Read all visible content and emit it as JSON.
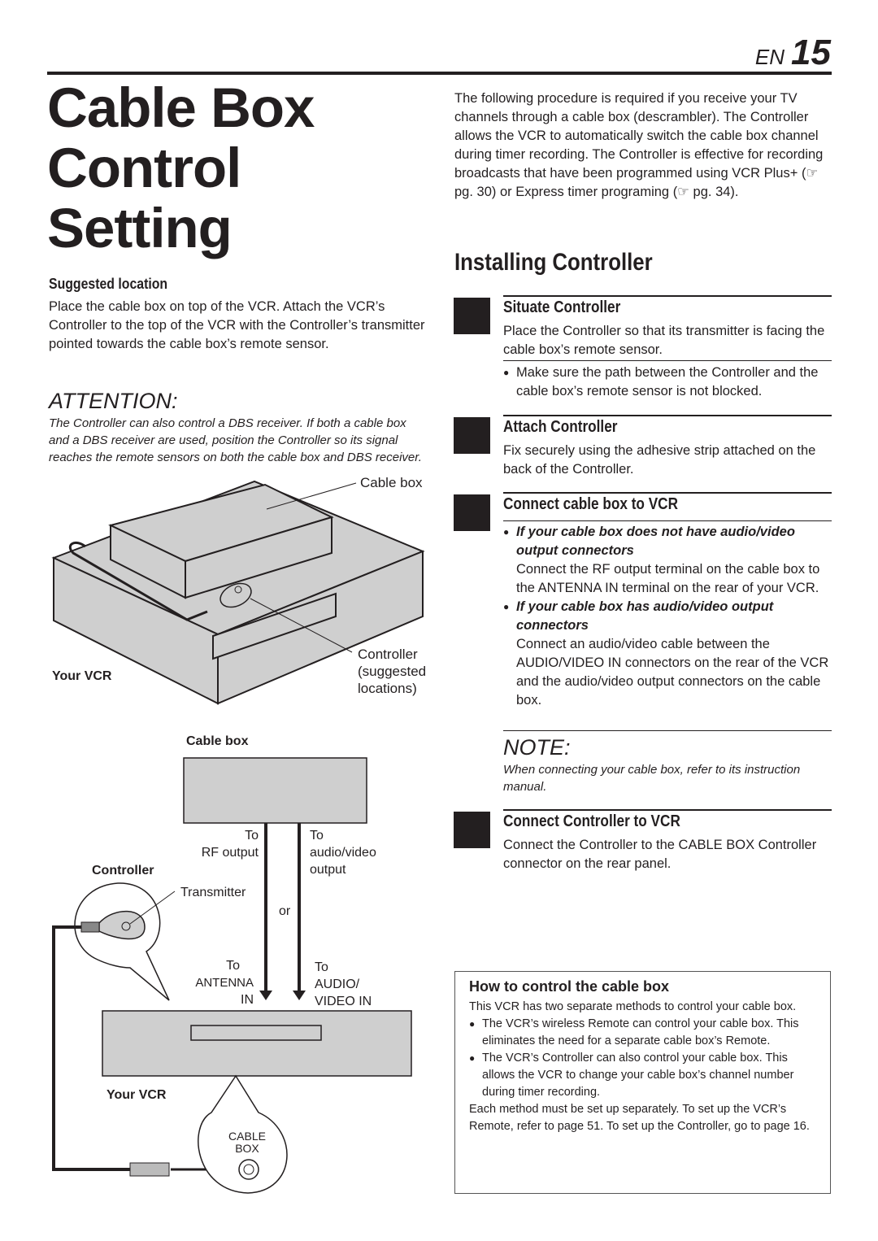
{
  "header": {
    "lang": "EN",
    "page_number": "15"
  },
  "title": {
    "line1": "Cable Box",
    "line2": "Control",
    "line3": "Setting"
  },
  "intro": "The following procedure is required if you receive your TV channels through a cable box (descrambler). The Controller allows the VCR to automatically switch the cable box channel during timer recording. The Controller is effective for recording broadcasts that have been programmed using VCR Plus+ (☞ pg. 30) or Express timer programing (☞ pg. 34).",
  "suggested": {
    "heading": "Suggested location",
    "text": "Place the cable box on top of the VCR. Attach the VCR’s Controller to the top of the VCR with the Controller’s transmitter pointed towards the cable box’s remote sensor."
  },
  "attention": {
    "heading": "ATTENTION:",
    "text": "The Controller can also control a DBS receiver. If both a cable box and a DBS receiver are used, position the Controller so its signal reaches the remote sensors on both the cable box and DBS receiver."
  },
  "figure1": {
    "cable_box_label": "Cable box",
    "your_vcr_label": "Your VCR",
    "controller_label_1": "Controller",
    "controller_label_2": "(suggested",
    "controller_label_3": "locations)"
  },
  "figure2": {
    "cable_box_label": "Cable box",
    "to_rf_1": "To",
    "to_rf_2": "RF output",
    "to_av_1": "To",
    "to_av_2": "audio/video",
    "to_av_3": "output",
    "controller_label": "Controller",
    "transmitter_label": "Transmitter",
    "or_label": "or",
    "to_ant_1": "To",
    "to_ant_2": "ANTENNA",
    "to_ant_3": "IN",
    "to_avin_1": "To",
    "to_avin_2": "AUDIO/",
    "to_avin_3": "VIDEO IN",
    "your_vcr_label": "Your VCR",
    "cable_box_jack_1": "CABLE",
    "cable_box_jack_2": "BOX"
  },
  "installing": {
    "heading": "Installing Controller",
    "steps": [
      {
        "title": "Situate Controller",
        "text": "Place the Controller so that its transmitter is facing the cable box’s remote sensor.",
        "bullet": "Make sure the path between the Controller and the cable box’s remote sensor is not blocked."
      },
      {
        "title": "Attach Controller",
        "text": "Fix securely using the adhesive strip attached on the back of the Controller."
      },
      {
        "title": "Connect cable box to VCR",
        "bullets": [
          {
            "heading": "If your cable box does not have audio/video output connectors",
            "text": "Connect the RF output terminal on the cable box to the ANTENNA IN terminal on the rear of your VCR."
          },
          {
            "heading": "If your cable box has audio/video output connectors",
            "text": "Connect an audio/video cable between the AUDIO/VIDEO IN connectors on the rear of the VCR and the audio/video output connectors on the cable box."
          }
        ]
      },
      {
        "title": "Connect Controller to VCR",
        "text": "Connect the Controller to the CABLE BOX Controller connector on the rear panel."
      }
    ]
  },
  "note": {
    "heading": "NOTE:",
    "text": "When connecting your cable box, refer to its instruction manual."
  },
  "howto": {
    "heading": "How to control the cable box",
    "intro": "This VCR has two separate methods to control your cable box.",
    "bullets": [
      "The VCR’s wireless Remote can control your cable box. This eliminates the need for a separate cable box’s Remote.",
      "The VCR’s Controller can also control your cable box. This allows the VCR to change your cable box’s channel number during timer recording."
    ],
    "outro": "Each method must be set up separately. To set up the VCR’s Remote, refer to page 51. To set up the Controller, go to page 16."
  }
}
